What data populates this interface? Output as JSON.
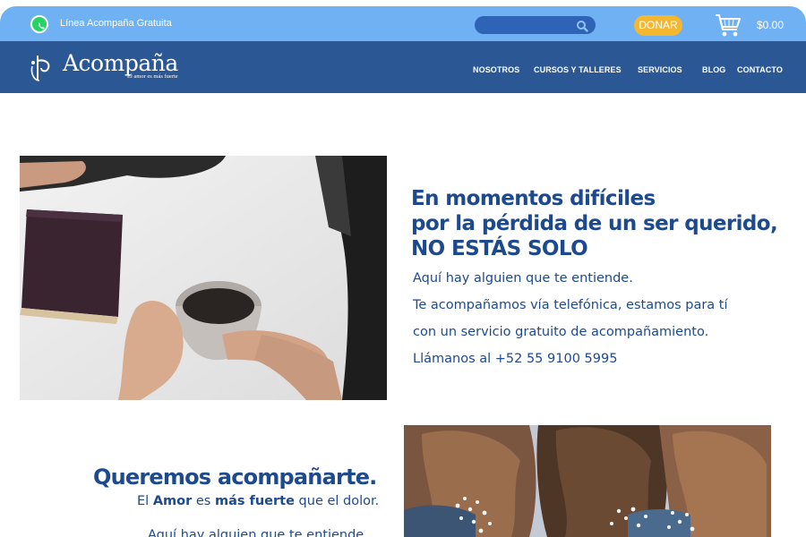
{
  "topbar": {
    "helpline_label": "Línea Acompaña Gratuita",
    "search_placeholder": "",
    "donate_label": "DONAR",
    "cart_total": "$0.00"
  },
  "brand": {
    "name": "Acompaña",
    "tagline": "El amor es más fuerte"
  },
  "nav": {
    "items": [
      {
        "label": "NOSOTROS"
      },
      {
        "label": "CURSOS Y TALLERES"
      },
      {
        "label": "SERVICIOS"
      },
      {
        "label": "BLOG"
      },
      {
        "label": "CONTACTO"
      }
    ]
  },
  "hero": {
    "title_lines": [
      "En momentos difíciles",
      "por la pérdida de un ser querido,",
      "NO ESTÁS SOLO"
    ],
    "body_lines": [
      "Aquí hay alguien que te entiende.",
      "Te acompañamos vía telefónica, estamos para tí",
      "con un servicio gratuito de acompañamiento.",
      "Llámanos al +52 55 9100 5995"
    ]
  },
  "section2": {
    "title": "Queremos acompañarte.",
    "sub_1": "El",
    "sub_2": "Amor",
    "sub_3": "es",
    "sub_4": "más fuerte",
    "sub_5": "que el dolor.",
    "cut_line": "Aquí hay alguien que te entiende."
  },
  "colors": {
    "topbar": "#6fb1f3",
    "navbar": "#2b5895",
    "accent_text": "#1d4a8f",
    "donate": "#f4b830",
    "whatsapp": "#25d366"
  },
  "icons": [
    "whatsapp-icon",
    "search-icon",
    "cart-icon",
    "logo-icon"
  ]
}
